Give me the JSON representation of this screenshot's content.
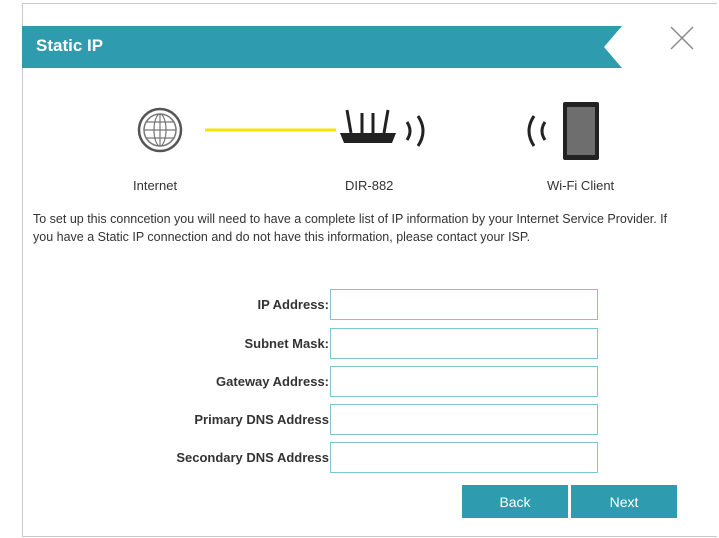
{
  "dialog": {
    "title": "Static IP",
    "close_icon": "close-icon",
    "accent_color": "#2e9cae"
  },
  "diagram": {
    "internet_label": "Internet",
    "router_label": "DIR-882",
    "client_label": "Wi-Fi Client",
    "link_color": "#f2e600"
  },
  "description": "To set up this conncetion you will need to have a complete list of IP information by your Internet Service Provider. If you have a Static IP connection and do not have this information, please contact your ISP.",
  "form": {
    "ip_address_label": "IP Address:",
    "ip_address_value": "",
    "subnet_mask_label": "Subnet Mask:",
    "subnet_mask_value": "",
    "gateway_label": "Gateway Address:",
    "gateway_value": "",
    "primary_dns_label": "Primary DNS Address",
    "primary_dns_value": "",
    "secondary_dns_label": "Secondary DNS Address",
    "secondary_dns_value": ""
  },
  "buttons": {
    "back_label": "Back",
    "next_label": "Next"
  }
}
